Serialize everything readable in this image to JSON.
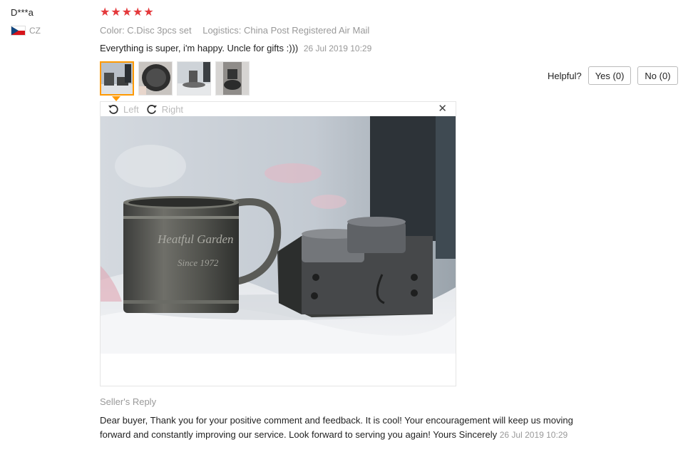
{
  "reviewer": {
    "name": "D***a",
    "country": "CZ",
    "flag_icon": "czech-flag-icon"
  },
  "rating": {
    "stars": 5,
    "max": 5,
    "star_color": "#e4393c"
  },
  "meta": {
    "color": "Color: C.Disc 3pcs set",
    "logistics": "Logistics: China Post Registered Air Mail"
  },
  "review": {
    "text": "Everything is super, i'm happy. Uncle for gifts :)))",
    "date": "26 Jul 2019 10:29"
  },
  "viewer": {
    "rotate_left": "Left",
    "rotate_right": "Right",
    "close_icon": "close-icon",
    "active_thumb_color": "#ff9900"
  },
  "helpful": {
    "label": "Helpful?",
    "yes": "Yes (0)",
    "no": "No (0)"
  },
  "seller_reply": {
    "title": "Seller's Reply",
    "text": "Dear buyer, Thank you for your positive comment and feedback. It is cool! Your encouragement will keep us moving forward and constantly improving our service. Look forward to serving you again! Yours Sincerely",
    "date": "26 Jul 2019 10:29"
  }
}
